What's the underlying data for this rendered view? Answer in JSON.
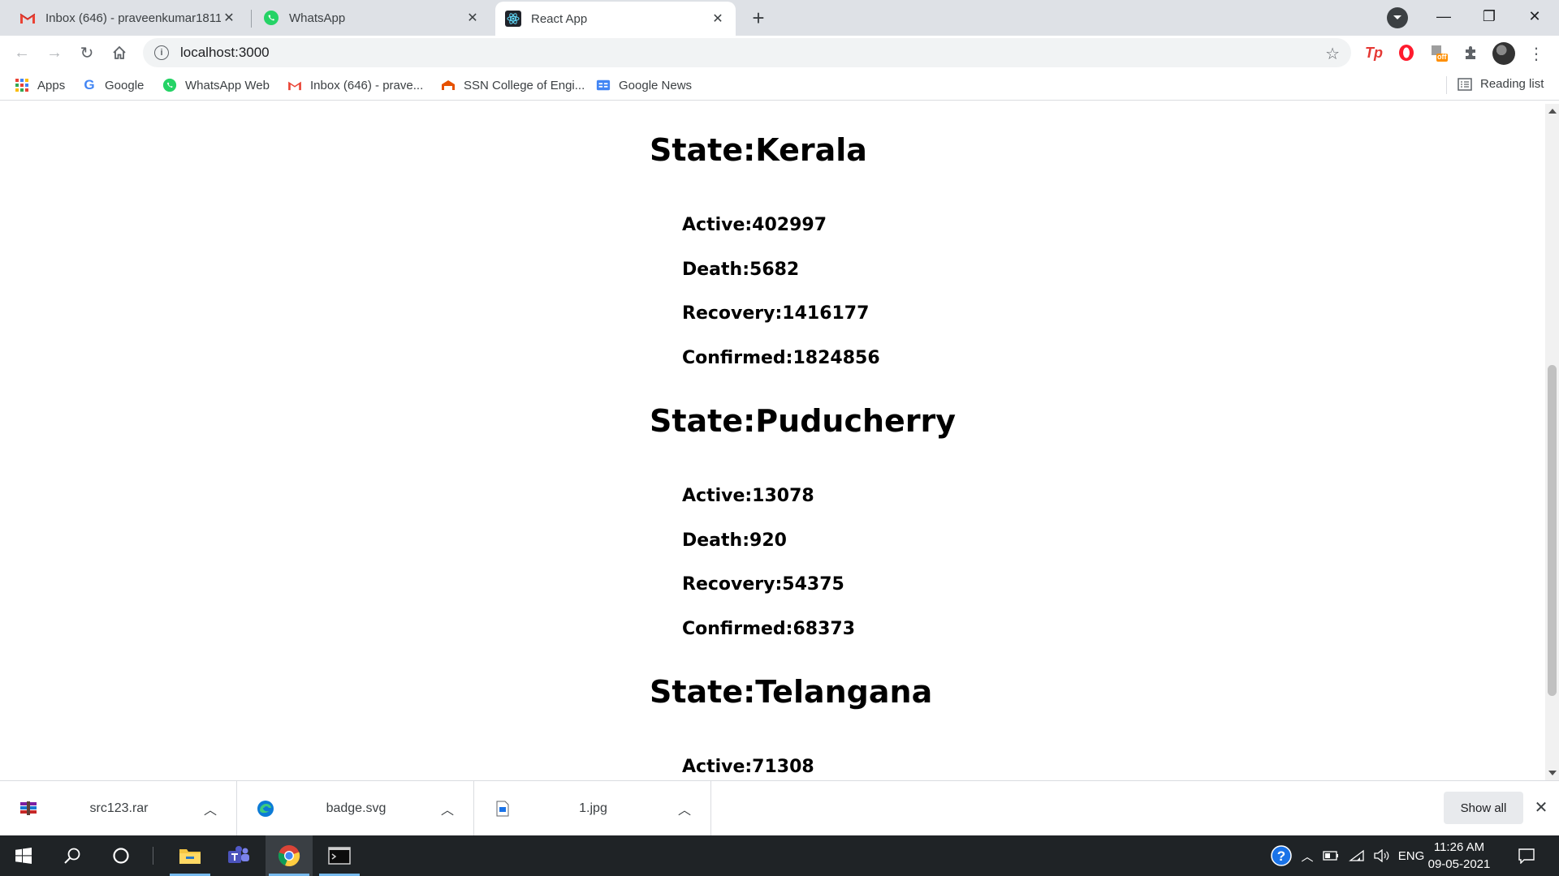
{
  "browser": {
    "tabs": [
      {
        "title": "Inbox (646) - praveenkumar1811",
        "icon": "gmail-icon",
        "active": false
      },
      {
        "title": "WhatsApp",
        "icon": "whatsapp-icon",
        "active": false
      },
      {
        "title": "React App",
        "icon": "react-icon",
        "active": true
      }
    ],
    "new_tab_symbol": "+",
    "window_controls": {
      "minimize": "—",
      "restore": "❐",
      "close": "✕"
    },
    "url": "localhost:3000",
    "bookmarks": [
      {
        "label": "Apps",
        "icon": "apps-grid-icon"
      },
      {
        "label": "Google",
        "icon": "google-icon"
      },
      {
        "label": "WhatsApp Web",
        "icon": "whatsapp-icon"
      },
      {
        "label": "Inbox (646) - prave...",
        "icon": "gmail-icon"
      },
      {
        "label": "SSN College of Engi...",
        "icon": "ssn-icon"
      },
      {
        "label": "Google News",
        "icon": "google-news-icon"
      }
    ],
    "reading_list": "Reading list",
    "extension_badge": "off"
  },
  "page": {
    "states": [
      {
        "heading": "State:Kerala",
        "stats": [
          "Active:402997",
          "Death:5682",
          "Recovery:1416177",
          "Confirmed:1824856"
        ]
      },
      {
        "heading": "State:Puducherry",
        "stats": [
          "Active:13078",
          "Death:920",
          "Recovery:54375",
          "Confirmed:68373"
        ]
      },
      {
        "heading": "State:Telangana",
        "stats": [
          "Active:71308"
        ]
      }
    ]
  },
  "downloads": {
    "items": [
      {
        "name": "src123.rar",
        "icon": "winrar-archive-icon"
      },
      {
        "name": "badge.svg",
        "icon": "edge-icon"
      },
      {
        "name": "1.jpg",
        "icon": "image-file-icon"
      }
    ],
    "show_all": "Show all"
  },
  "taskbar": {
    "apps": [
      "start-icon",
      "search-icon",
      "cortana-icon",
      "file-explorer-icon",
      "teams-icon",
      "chrome-icon",
      "terminal-icon"
    ],
    "language": "ENG",
    "time": "11:26 AM",
    "date": "09-05-2021"
  },
  "colors": {
    "tabstrip": "#dee1e6",
    "omnibox": "#f1f3f4",
    "taskbar": "#1f2326",
    "page_text": "#000000"
  }
}
